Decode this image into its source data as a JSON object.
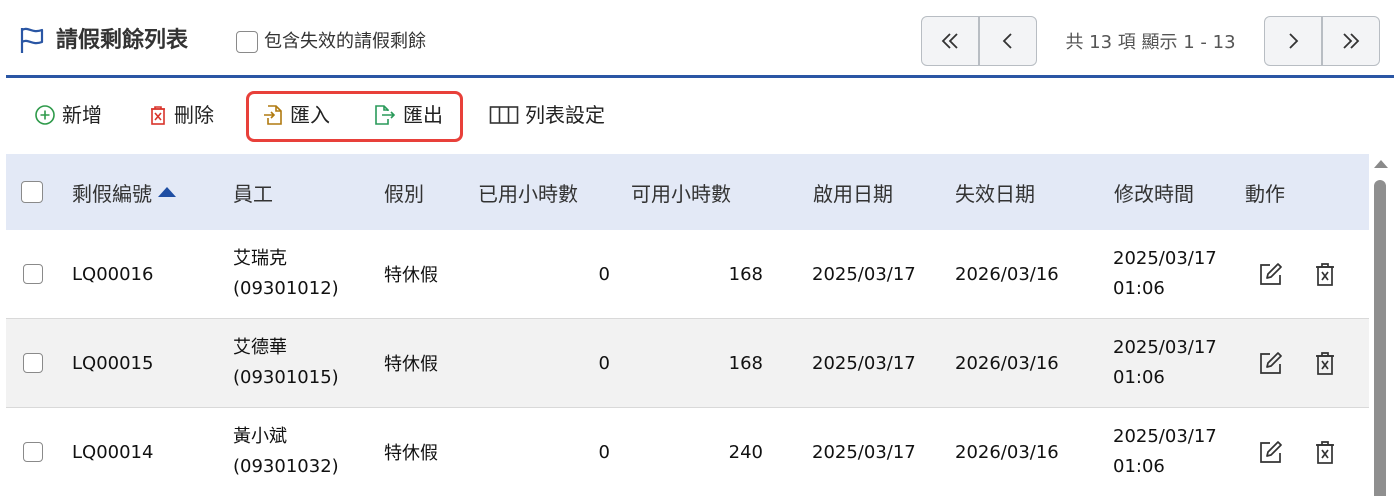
{
  "header": {
    "title": "請假剩餘列表",
    "include_expired_label": "包含失效的請假剩餘",
    "pagination_info": "共 13 項 顯示 1 - 13"
  },
  "toolbar": {
    "add": "新增",
    "delete": "刪除",
    "import": "匯入",
    "export": "匯出",
    "list_settings": "列表設定"
  },
  "table": {
    "columns": [
      "剩假編號",
      "員工",
      "假別",
      "已用小時數",
      "可用小時數",
      "啟用日期",
      "失效日期",
      "修改時間",
      "動作"
    ],
    "rows": [
      {
        "id": "LQ00016",
        "employee_name": "艾瑞克",
        "employee_code": "(09301012)",
        "leave_type": "特休假",
        "used_hours": "0",
        "available_hours": "168",
        "start_date": "2025/03/17",
        "end_date": "2026/03/16",
        "modified_date": "2025/03/17",
        "modified_time": "01:06"
      },
      {
        "id": "LQ00015",
        "employee_name": "艾德華",
        "employee_code": "(09301015)",
        "leave_type": "特休假",
        "used_hours": "0",
        "available_hours": "168",
        "start_date": "2025/03/17",
        "end_date": "2026/03/16",
        "modified_date": "2025/03/17",
        "modified_time": "01:06"
      },
      {
        "id": "LQ00014",
        "employee_name": "黃小斌",
        "employee_code": "(09301032)",
        "leave_type": "特休假",
        "used_hours": "0",
        "available_hours": "240",
        "start_date": "2025/03/17",
        "end_date": "2026/03/16",
        "modified_date": "2025/03/17",
        "modified_time": "01:06"
      }
    ]
  },
  "colors": {
    "accent": "#2a56a4",
    "header_bg": "#e3e9f6",
    "highlight": "#e8403a",
    "import_icon": "#b07a10",
    "export_icon": "#2a9a5a",
    "delete_icon": "#d9342b",
    "add_icon": "#2e9a4a"
  },
  "icons": {
    "title": "flag-icon",
    "add": "plus-circle-icon",
    "delete": "trash-icon",
    "import": "file-import-icon",
    "export": "file-export-icon",
    "list_settings": "columns-icon",
    "edit": "edit-icon",
    "row_delete": "trash-icon"
  }
}
